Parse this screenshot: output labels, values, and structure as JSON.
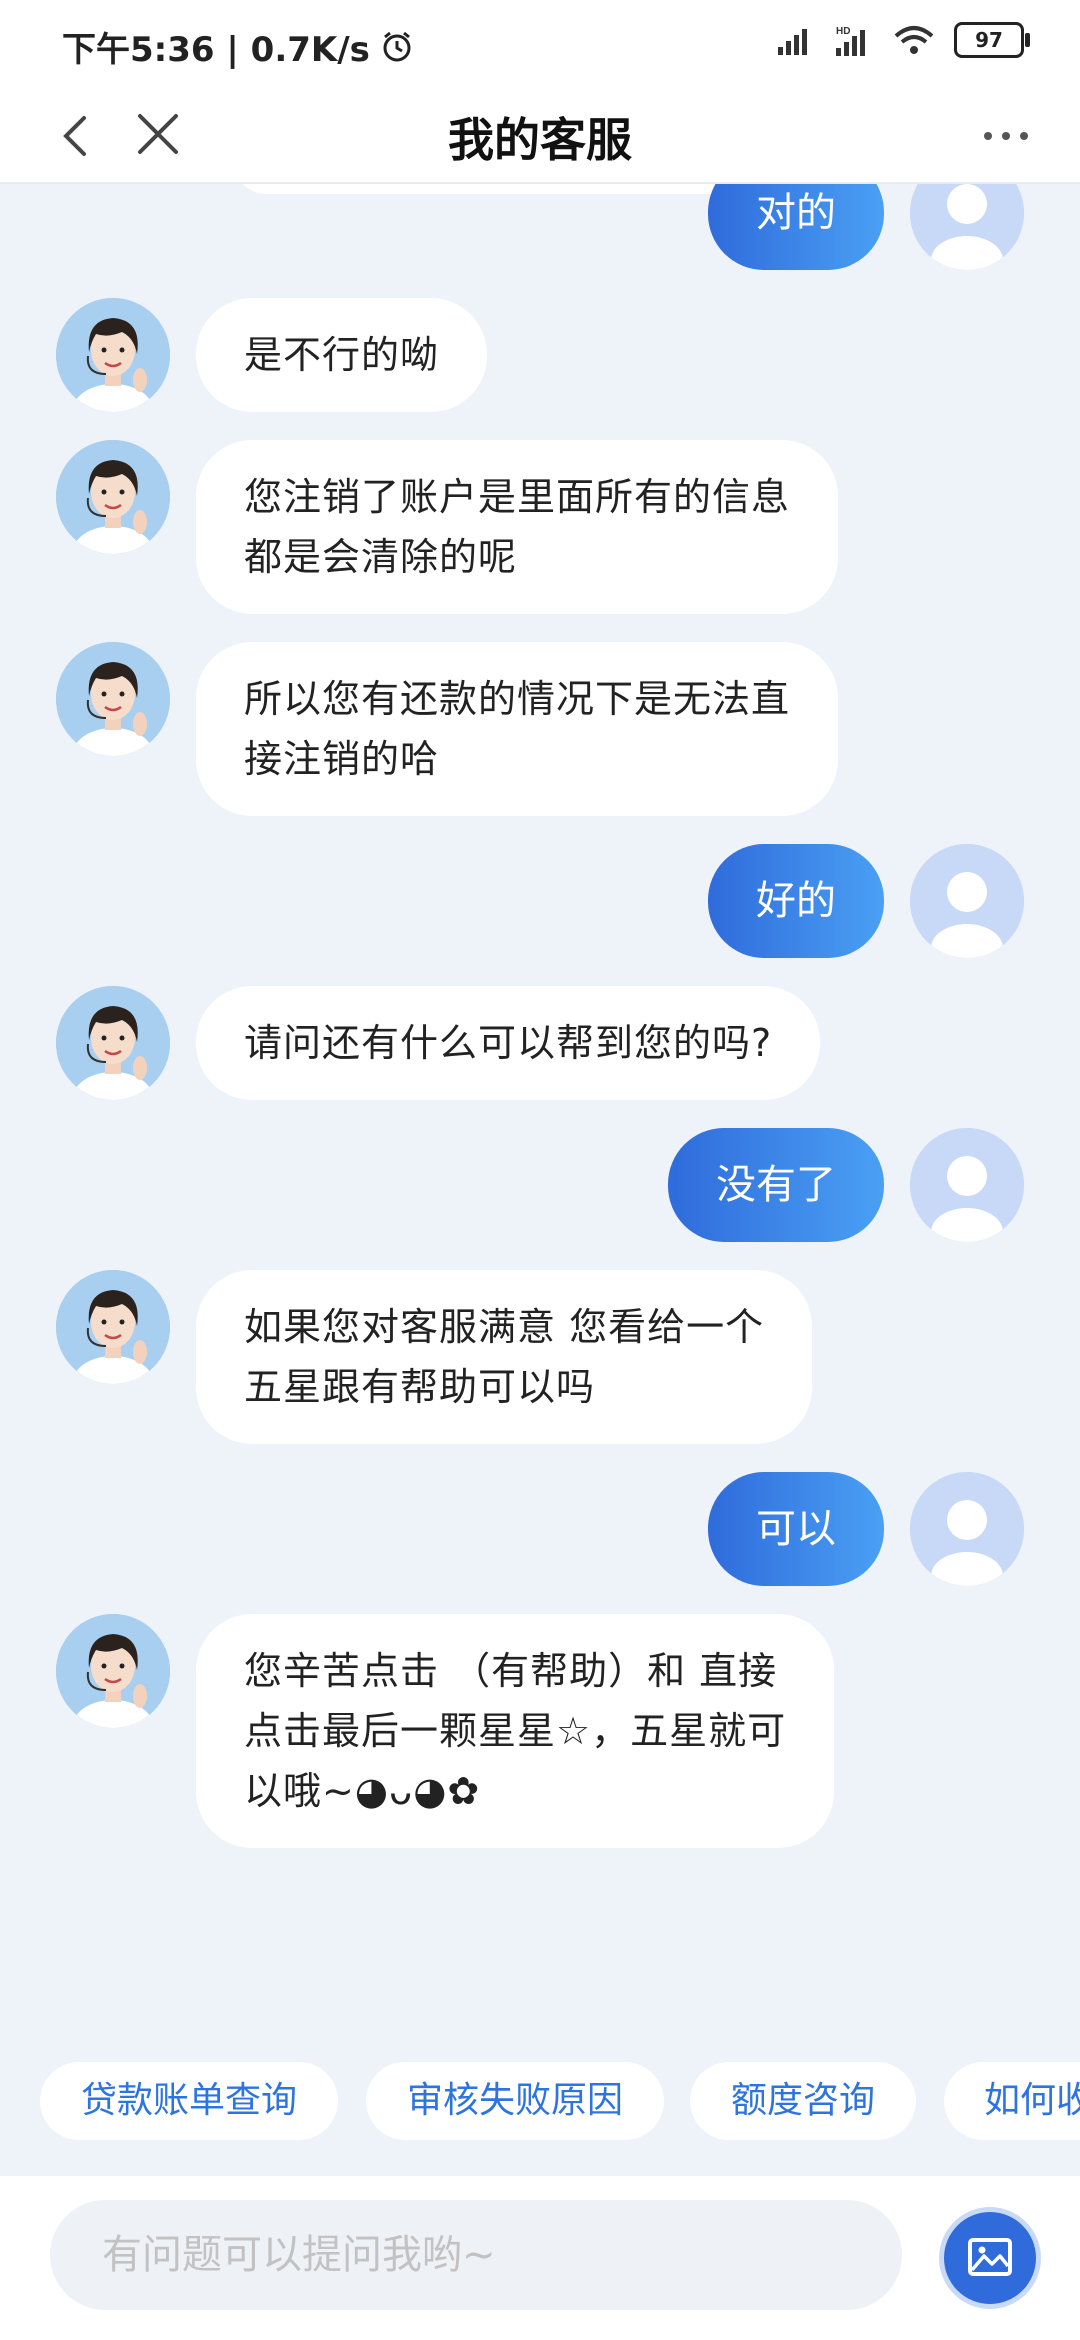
{
  "status": {
    "time": "下午5:36 | 0.7K/s",
    "battery": "97"
  },
  "header": {
    "title": "我的客服"
  },
  "messages": [
    {
      "from": "user",
      "text": "对的"
    },
    {
      "from": "agent",
      "lines": [
        "是不行的呦"
      ]
    },
    {
      "from": "agent",
      "lines": [
        "您注销了账户是里面所有的信息",
        "都是会清除的呢"
      ]
    },
    {
      "from": "agent",
      "lines": [
        "所以您有还款的情况下是无法直",
        "接注销的哈"
      ]
    },
    {
      "from": "user",
      "text": "好的"
    },
    {
      "from": "agent",
      "lines": [
        "请问还有什么可以帮到您的吗?"
      ]
    },
    {
      "from": "user",
      "text": "没有了"
    },
    {
      "from": "agent",
      "lines": [
        "如果您对客服满意 您看给一个",
        "五星跟有帮助可以吗"
      ]
    },
    {
      "from": "user",
      "text": "可以"
    },
    {
      "from": "agent",
      "lines": [
        "您辛苦点击 （有帮助）和 直接",
        "点击最后一颗星星☆，五星就可",
        "以哦~◕ᴗ◕✿"
      ]
    }
  ],
  "quick_replies": [
    "贷款账单查询",
    "审核失败原因",
    "额度咨询",
    "如何收"
  ],
  "input": {
    "placeholder": "有问题可以提问我哟~"
  },
  "colors": {
    "accent": "#2f6bdb",
    "background": "#eef2f9"
  },
  "icons": {
    "back": "chevron-left-icon",
    "close": "close-icon",
    "more": "more-dots-icon",
    "image": "image-icon"
  }
}
